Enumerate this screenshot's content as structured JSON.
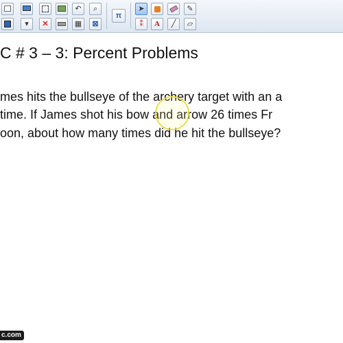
{
  "toolbar": {
    "icons": [
      "pages-icon",
      "monitor-icon",
      "capture-icon",
      "gallery-icon",
      "undo-icon",
      "zoom-icon",
      "save-icon",
      "display-icon",
      "delete-icon",
      "screen-shade-icon",
      "table-icon",
      "close-icon",
      "math-icon",
      "select-arrow-icon",
      "paint-bucket-icon",
      "eraser-icon",
      "pen-tool-icon",
      "creative-pens-icon",
      "text-tool-icon",
      "line-tool-icon",
      "highlighter-icon"
    ],
    "math_glyph": "π",
    "text_glyph": "A"
  },
  "title": "C # 3 – 3: Percent Problems",
  "body_lines": [
    "mes hits the bullseye of the archery target with an a",
    "time.  If James shot his bow and arrow 26 times Fr",
    "oon, about how many times did he hit the bullseye?"
  ],
  "watermark": "c.com",
  "colors": {
    "highlight_ring": "#e8da3c",
    "toolbar_bg": "#dde6f1"
  }
}
